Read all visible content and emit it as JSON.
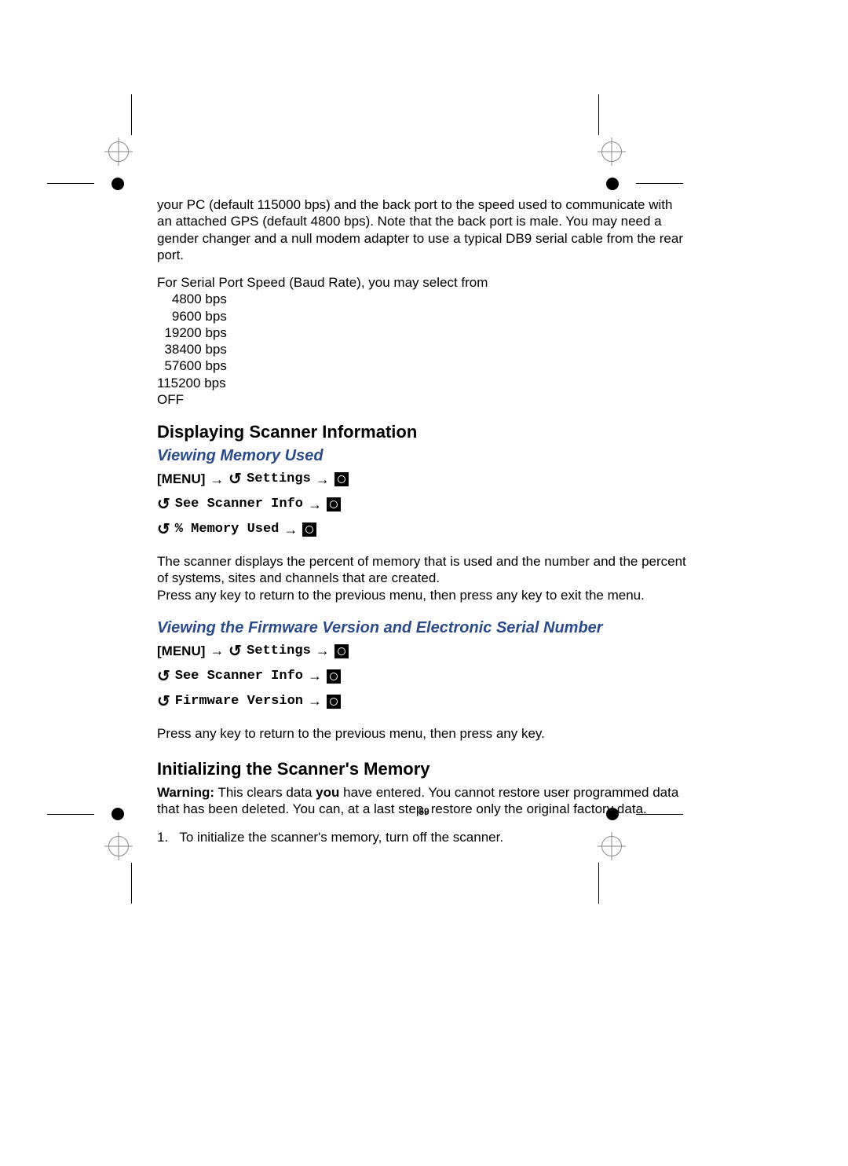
{
  "page_number": "59",
  "intro_paragraph": "your PC (default 115000 bps) and the back port to the speed used to communicate with an attached GPS (default 4800 bps). Note that the back port is male. You may need a gender changer and a null modem adapter to use a typical DB9 serial cable from the rear port.",
  "baud_intro": "For Serial Port Speed (Baud Rate), you may select from",
  "baud_rates": [
    "    4800 bps",
    "    9600 bps",
    "  19200 bps",
    "  38400 bps",
    "  57600 bps",
    "115200 bps"
  ],
  "baud_off": "OFF",
  "heading_display": "Displaying Scanner Information",
  "sub_memory": "Viewing Memory Used",
  "menu_label": "[MENU]",
  "settings_label": "Settings",
  "see_scanner_info": "See Scanner Info",
  "pct_memory_used": "% Memory Used",
  "memory_paragraph_1": "The scanner displays the percent of memory that is used and the number and the percent of systems, sites and channels that are created.",
  "memory_paragraph_2": "Press any key to return to the previous menu, then press any key to exit the menu.",
  "sub_firmware": "Viewing the Firmware Version and Electronic Serial Number",
  "firmware_version": "Firmware Version",
  "firmware_paragraph": "Press any key to return to the previous menu, then press any key.",
  "heading_init": "Initializing the Scanner's Memory",
  "warning_label": "Warning:",
  "warning_text_1": " This clears data ",
  "warning_you": "you",
  "warning_text_2": " have entered. You cannot restore user programmed data that has been deleted. You can, at a last step, restore only the original factory data.",
  "step1_num": "1.",
  "step1_text": "To initialize the scanner's memory, turn off the scanner."
}
